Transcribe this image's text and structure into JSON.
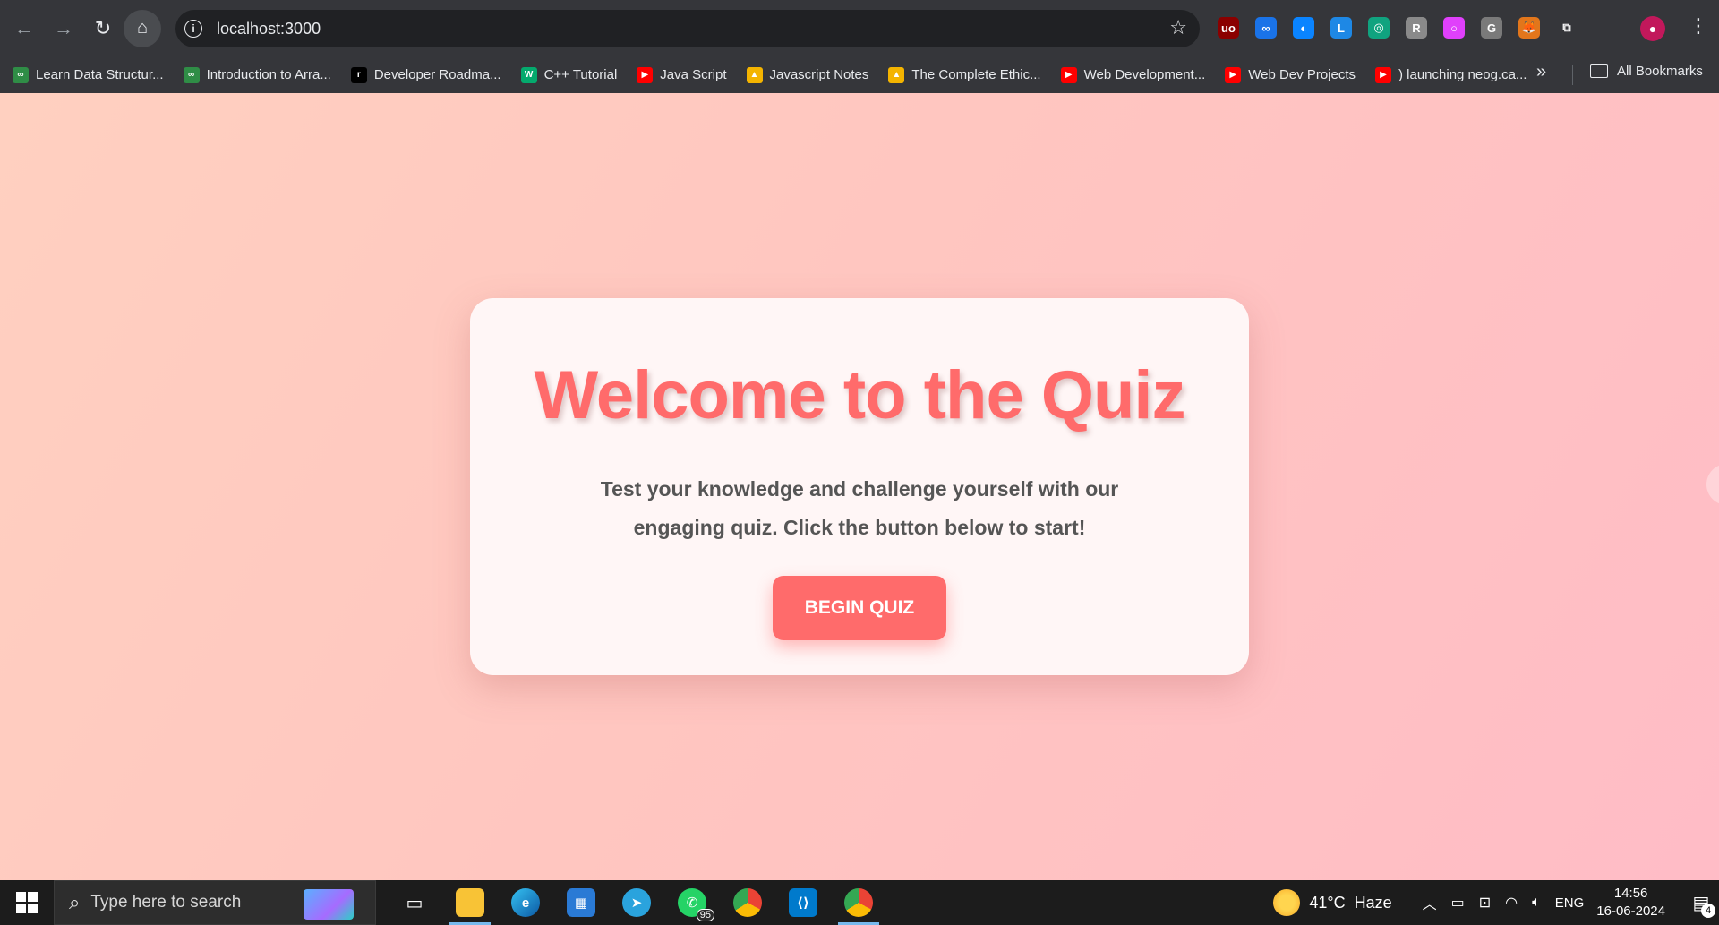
{
  "browser": {
    "url": "localhost:3000",
    "extensions": [
      {
        "name": "ublock-icon",
        "glyph": "uo",
        "color": "#8b0000"
      },
      {
        "name": "infinity-icon",
        "glyph": "∞",
        "color": "#1a73e8"
      },
      {
        "name": "edge-ext-icon",
        "glyph": "◐",
        "color": "#0a84ff"
      },
      {
        "name": "leetcode-icon",
        "glyph": "L",
        "color": "#1e88e5"
      },
      {
        "name": "chatgpt-icon",
        "glyph": "◎",
        "color": "#10a37f"
      },
      {
        "name": "r-ext-icon",
        "glyph": "R",
        "color": "#8a8a8a"
      },
      {
        "name": "color-ring-icon",
        "glyph": "○",
        "color": "#e040fb"
      },
      {
        "name": "grammarly-icon",
        "glyph": "G",
        "color": "#7a7a7a"
      },
      {
        "name": "metamask-icon",
        "glyph": "🦊",
        "color": "#e2761b"
      },
      {
        "name": "extensions-puzzle-icon",
        "glyph": "⧉",
        "color": "transparent"
      }
    ]
  },
  "bookmarks": {
    "items": [
      {
        "label": "Learn Data Structur...",
        "icon": "gfg-icon",
        "glyph": "∞",
        "color": "#2f8d46"
      },
      {
        "label": "Introduction to Arra...",
        "icon": "gfg-icon",
        "glyph": "∞",
        "color": "#2f8d46"
      },
      {
        "label": "Developer Roadma...",
        "icon": "roadmap-icon",
        "glyph": "r",
        "color": "#000000"
      },
      {
        "label": "C++ Tutorial",
        "icon": "w3schools-icon",
        "glyph": "W",
        "color": "#04aa6d"
      },
      {
        "label": "Java Script",
        "icon": "youtube-icon",
        "glyph": "▶",
        "color": "#ff0000"
      },
      {
        "label": "Javascript Notes",
        "icon": "google-drive-icon",
        "glyph": "▲",
        "color": "#f4b400"
      },
      {
        "label": "The Complete Ethic...",
        "icon": "google-drive-icon",
        "glyph": "▲",
        "color": "#f4b400"
      },
      {
        "label": "Web Development...",
        "icon": "youtube-icon",
        "glyph": "▶",
        "color": "#ff0000"
      },
      {
        "label": "Web Dev Projects",
        "icon": "youtube-icon",
        "glyph": "▶",
        "color": "#ff0000"
      },
      {
        "label": ") launching neog.ca...",
        "icon": "youtube-icon",
        "glyph": "▶",
        "color": "#ff0000"
      }
    ],
    "all_label": "All Bookmarks"
  },
  "quiz": {
    "title": "Welcome to the Quiz",
    "description": "Test your knowledge and challenge yourself with our engaging quiz. Click the button below to start!",
    "button": "BEGIN QUIZ",
    "accent": "#ff6b6b"
  },
  "taskbar": {
    "search_placeholder": "Type here to search",
    "whatsapp_badge": "95",
    "weather": "41°C  Haze",
    "language": "ENG",
    "time": "14:56",
    "date": "16-06-2024",
    "notifications": "4"
  }
}
